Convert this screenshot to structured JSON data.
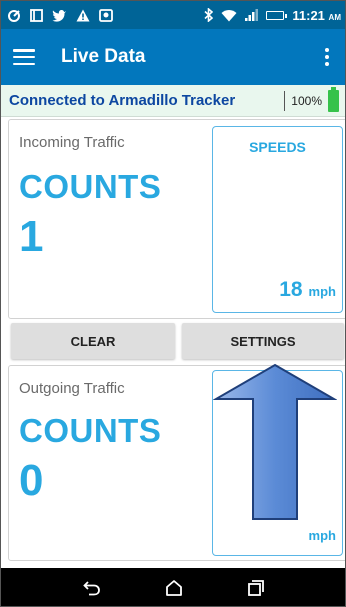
{
  "status_bar": {
    "left_icons": [
      "wifi-calling-icon",
      "cast-icon",
      "twitter-icon",
      "warning-icon",
      "image-icon"
    ],
    "right_icons": [
      "bluetooth-icon",
      "wifi-icon",
      "signal-icon",
      "battery-icon"
    ],
    "time": "11:21",
    "ampm": "AM"
  },
  "app_bar": {
    "title": "Live Data",
    "menu_icon": "hamburger-menu-icon",
    "overflow_icon": "more-vert-icon"
  },
  "connection": {
    "text": "Connected to Armadillo Tracker",
    "battery_percent": "100%",
    "battery_color": "#36c24b"
  },
  "incoming": {
    "label": "Incoming Traffic",
    "counts_label": "COUNTS",
    "count": "1",
    "speeds_title": "SPEEDS",
    "speed_value": "18",
    "speed_unit": "mph"
  },
  "buttons": {
    "clear": "CLEAR",
    "settings": "SETTINGS"
  },
  "outgoing": {
    "label": "Outgoing Traffic",
    "counts_label": "COUNTS",
    "count": "0",
    "speed_unit": "mph"
  },
  "nav_bar": {
    "icons": [
      "back-icon",
      "home-icon",
      "recents-icon"
    ]
  },
  "colors": {
    "status_bar": "#006497",
    "app_bar": "#0277bd",
    "accent": "#29a8e0",
    "connection_text": "#0d47a1",
    "annotation_arrow": "#5b8bd6"
  }
}
